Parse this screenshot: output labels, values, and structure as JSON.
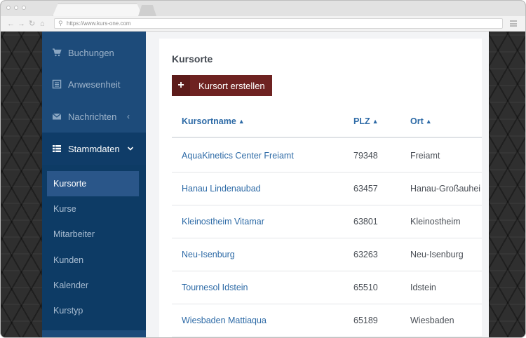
{
  "browser": {
    "url": "https://www.kurs-one.com"
  },
  "sidebar": {
    "items": [
      {
        "label": "Buchungen",
        "icon": "cart-icon"
      },
      {
        "label": "Anwesenheit",
        "icon": "list-icon"
      },
      {
        "label": "Nachrichten",
        "icon": "envelope-icon"
      },
      {
        "label": "Stammdaten",
        "icon": "table-list-icon"
      }
    ],
    "sub_items": [
      "Kursorte",
      "Kurse",
      "Mitarbeiter",
      "Kunden",
      "Kalender",
      "Kurstyp"
    ],
    "selected_sub_item": "Kursorte"
  },
  "main": {
    "title": "Kursorte",
    "create_button": "Kursort erstellen",
    "table": {
      "columns": [
        "Kursortname",
        "PLZ",
        "Ort"
      ],
      "rows": [
        {
          "name": "AquaKinetics Center Freiamt",
          "plz": "79348",
          "ort": "Freiamt"
        },
        {
          "name": "Hanau Lindenaubad",
          "plz": "63457",
          "ort": "Hanau-Großauhei"
        },
        {
          "name": "Kleinostheim Vitamar",
          "plz": "63801",
          "ort": "Kleinostheim"
        },
        {
          "name": "Neu-Isenburg",
          "plz": "63263",
          "ort": "Neu-Isenburg"
        },
        {
          "name": "Tournesol Idstein",
          "plz": "65510",
          "ort": "Idstein"
        },
        {
          "name": "Wiesbaden Mattiaqua",
          "plz": "65189",
          "ort": "Wiesbaden"
        }
      ]
    }
  },
  "colors": {
    "sidebar": "#0d3b65",
    "sidebar_top": "#1d4b7a",
    "selected_item": "#2a5689",
    "link": "#2d6aa6",
    "button": "#6e2221"
  }
}
